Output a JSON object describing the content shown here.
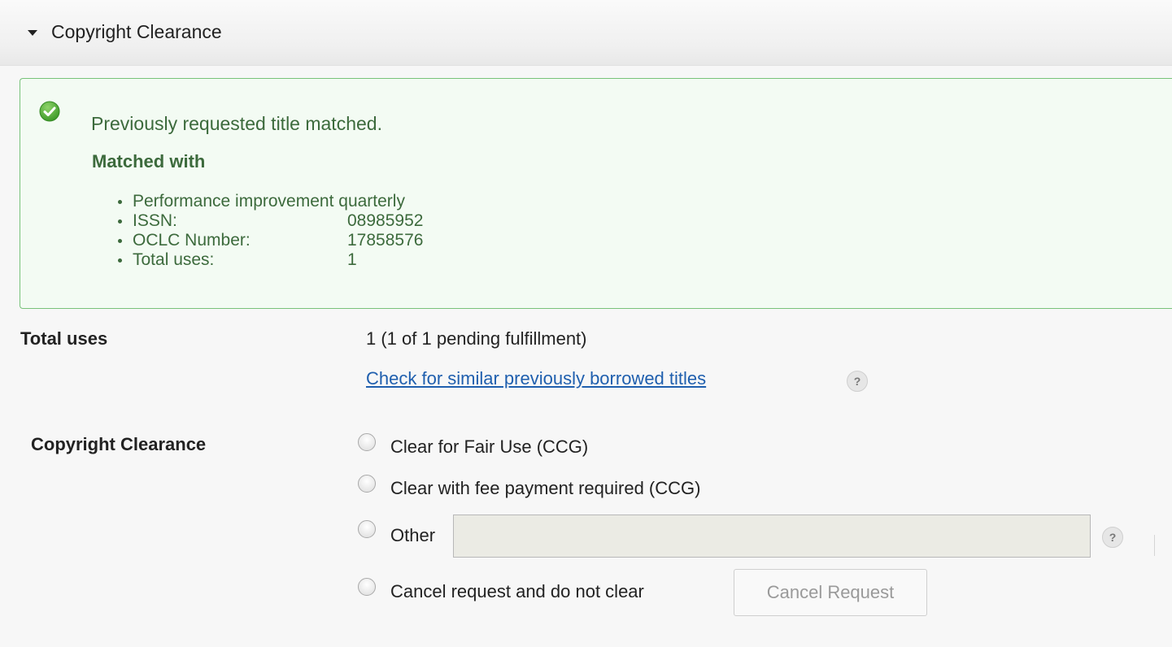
{
  "section": {
    "title": "Copyright Clearance"
  },
  "alert": {
    "message": "Previously requested title matched.",
    "matched_title": "Matched with",
    "items": [
      {
        "label": "Performance improvement quarterly",
        "value": ""
      },
      {
        "label": "ISSN:",
        "value": "08985952"
      },
      {
        "label": "OCLC Number:",
        "value": "17858576"
      },
      {
        "label": "Total uses:",
        "value": "1"
      }
    ]
  },
  "total_uses": {
    "label": "Total uses",
    "value": "1 (1 of 1 pending fulfillment)",
    "link": "Check for similar previously borrowed titles"
  },
  "clearance": {
    "label": "Copyright Clearance",
    "options": [
      "Clear for Fair Use (CCG)",
      "Clear with fee payment required (CCG)",
      "Other",
      "Cancel request and do not clear"
    ],
    "other_value": "",
    "cancel_button": "Cancel Request"
  },
  "icons": {
    "caret": "caret-down-icon",
    "check": "check-circle-icon",
    "help": "help-icon"
  },
  "help_glyph": "?",
  "colors": {
    "success_border": "#78c27a",
    "success_bg": "#f3fbf3",
    "success_text": "#3c6a3c",
    "link": "#1f5fae"
  }
}
